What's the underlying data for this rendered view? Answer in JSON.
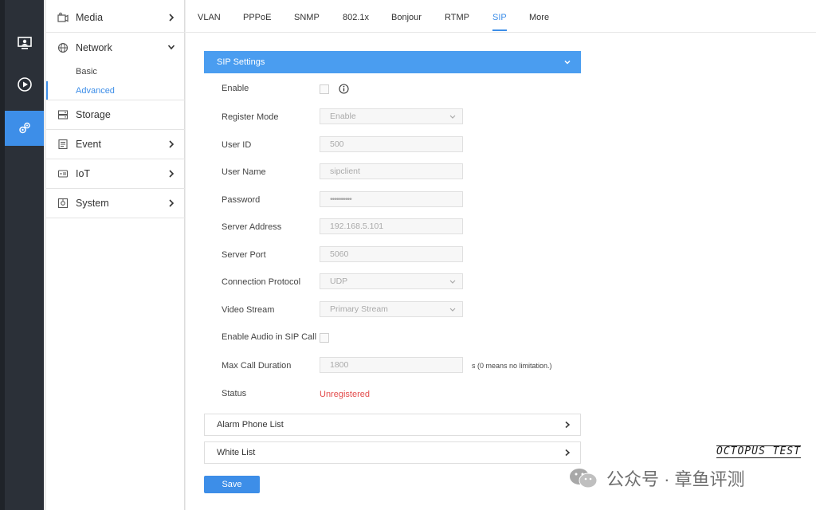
{
  "rail": {
    "items": [
      {
        "icon": "live-view-icon"
      },
      {
        "icon": "playback-icon"
      },
      {
        "icon": "settings-icon",
        "active": true
      }
    ]
  },
  "sidebar": {
    "items": [
      {
        "label": "Media",
        "icon": "media-icon"
      },
      {
        "label": "Network",
        "icon": "globe-icon"
      },
      {
        "label": "Storage",
        "icon": "storage-icon"
      },
      {
        "label": "Event",
        "icon": "event-icon"
      },
      {
        "label": "IoT",
        "icon": "iot-icon"
      },
      {
        "label": "System",
        "icon": "system-icon"
      }
    ],
    "sub_items": [
      {
        "label": "Basic"
      },
      {
        "label": "Advanced",
        "active": true
      }
    ]
  },
  "tabs": [
    "VLAN",
    "PPPoE",
    "SNMP",
    "802.1x",
    "Bonjour",
    "RTMP",
    "SIP",
    "More"
  ],
  "active_tab": "SIP",
  "sip": {
    "panel_title": "SIP Settings",
    "labels": {
      "enable": "Enable",
      "register_mode": "Register Mode",
      "user_id": "User ID",
      "user_name": "User Name",
      "password": "Password",
      "server_address": "Server Address",
      "server_port": "Server Port",
      "connection_protocol": "Connection Protocol",
      "video_stream": "Video Stream",
      "enable_audio": "Enable Audio in SIP Call",
      "max_call_duration": "Max Call Duration",
      "status": "Status"
    },
    "values": {
      "register_mode": "Enable",
      "user_id": "500",
      "user_name": "sipclient",
      "password": "••••••••••",
      "server_address": "192.168.5.101",
      "server_port": "5060",
      "connection_protocol": "UDP",
      "video_stream": "Primary Stream",
      "max_call_duration": "1800",
      "status": "Unregistered"
    },
    "max_call_hint": "s (0 means no limitation.)"
  },
  "sections": {
    "alarm_phone_list": "Alarm Phone List",
    "white_list": "White List"
  },
  "save_label": "Save",
  "watermark": {
    "logo": "OCTOPUS TEST",
    "text": "公众号 · 章鱼评测"
  },
  "colors": {
    "accent": "#3d8ee8",
    "panel_header": "#4a9df0",
    "status_error": "#e34c4c",
    "rail_bg": "#2b3038"
  }
}
